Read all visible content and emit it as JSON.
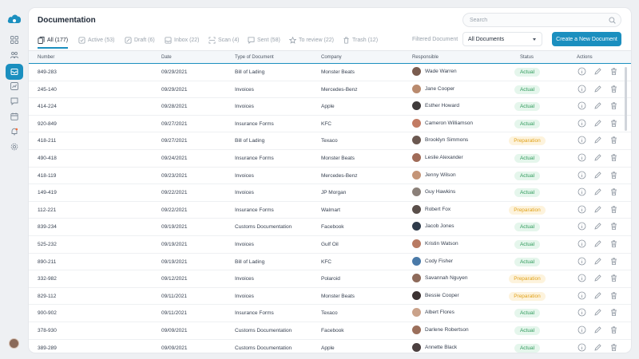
{
  "title": "Documentation",
  "search": {
    "placeholder": "Search"
  },
  "tabs": [
    {
      "label": "All (177)",
      "icon": "all-documents-icon"
    },
    {
      "label": "Active (53)",
      "icon": "active-icon"
    },
    {
      "label": "Draft (6)",
      "icon": "draft-icon"
    },
    {
      "label": "Inbox (22)",
      "icon": "inbox-icon"
    },
    {
      "label": "Scan (4)",
      "icon": "scan-icon"
    },
    {
      "label": "Sent (58)",
      "icon": "sent-icon"
    },
    {
      "label": "To review (22)",
      "icon": "star-icon"
    },
    {
      "label": "Trash (12)",
      "icon": "trash-icon"
    }
  ],
  "filter": {
    "label": "Filtered Document",
    "selected": "All Documents"
  },
  "create_button": "Create a New Document",
  "columns": [
    "Number",
    "Date",
    "Type of Document",
    "Company",
    "Responsible",
    "Status",
    "Actions"
  ],
  "rows": [
    {
      "number": "849-283",
      "date": "09/29/2021",
      "type": "Bill of Lading",
      "company": "Monster Beats",
      "responsible": "Wade Warren",
      "status": "Actual"
    },
    {
      "number": "245-140",
      "date": "09/29/2021",
      "type": "Invoices",
      "company": "Mercedes-Benz",
      "responsible": "Jane Cooper",
      "status": "Actual"
    },
    {
      "number": "414-224",
      "date": "09/28/2021",
      "type": "Invoices",
      "company": "Apple",
      "responsible": "Esther Howard",
      "status": "Actual"
    },
    {
      "number": "920-849",
      "date": "09/27/2021",
      "type": "Insurance Forms",
      "company": "KFC",
      "responsible": "Cameron Williamson",
      "status": "Actual"
    },
    {
      "number": "418-211",
      "date": "09/27/2021",
      "type": "Bill of Lading",
      "company": "Texaco",
      "responsible": "Brooklyn Simmons",
      "status": "Preparation"
    },
    {
      "number": "490-418",
      "date": "09/24/2021",
      "type": "Insurance Forms",
      "company": "Monster Beats",
      "responsible": "Leslie Alexander",
      "status": "Actual"
    },
    {
      "number": "418-119",
      "date": "09/23/2021",
      "type": "Invoices",
      "company": "Mercedes-Benz",
      "responsible": "Jenny Wilson",
      "status": "Actual"
    },
    {
      "number": "149-419",
      "date": "09/22/2021",
      "type": "Invoices",
      "company": "JP Morgan",
      "responsible": "Guy Hawkins",
      "status": "Actual"
    },
    {
      "number": "112-221",
      "date": "09/22/2021",
      "type": "Insurance Forms",
      "company": "Walmart",
      "responsible": "Robert Fox",
      "status": "Preparation"
    },
    {
      "number": "839-234",
      "date": "09/19/2021",
      "type": "Customs Documentation",
      "company": "Facebook",
      "responsible": "Jacob Jones",
      "status": "Actual"
    },
    {
      "number": "525-232",
      "date": "09/19/2021",
      "type": "Invoices",
      "company": "Gulf Oil",
      "responsible": "Kristin Watson",
      "status": "Actual"
    },
    {
      "number": "890-211",
      "date": "09/19/2021",
      "type": "Bill of Lading",
      "company": "KFC",
      "responsible": "Cody Fisher",
      "status": "Actual"
    },
    {
      "number": "332-982",
      "date": "09/12/2021",
      "type": "Invoices",
      "company": "Polaroid",
      "responsible": "Savannah Nguyen",
      "status": "Preparation"
    },
    {
      "number": "829-112",
      "date": "09/11/2021",
      "type": "Invoices",
      "company": "Monster Beats",
      "responsible": "Bessie Cooper",
      "status": "Preparation"
    },
    {
      "number": "900-902",
      "date": "09/11/2021",
      "type": "Insurance Forms",
      "company": "Texaco",
      "responsible": "Albert Flores",
      "status": "Actual"
    },
    {
      "number": "378-930",
      "date": "09/09/2021",
      "type": "Customs Documentation",
      "company": "Facebook",
      "responsible": "Darlene Robertson",
      "status": "Actual"
    },
    {
      "number": "389-289",
      "date": "09/09/2021",
      "type": "Customs Documentation",
      "company": "Apple",
      "responsible": "Annette Black",
      "status": "Actual"
    }
  ],
  "row_actions": [
    "info-icon",
    "edit-icon",
    "delete-icon"
  ],
  "sidebar_icons": [
    "dashboard-icon",
    "team-icon",
    "documents-icon",
    "reports-icon",
    "messages-icon",
    "calendar-icon",
    "notifications-icon",
    "settings-icon"
  ],
  "colors": {
    "accent": "#1b8fbf",
    "actual_bg": "#e5f6ec",
    "actual_text": "#2f9a5b",
    "prep_bg": "#fdf3dd",
    "prep_text": "#e1a31c"
  }
}
